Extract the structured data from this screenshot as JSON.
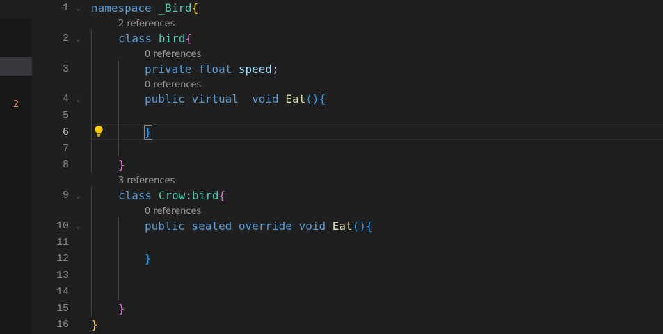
{
  "gutter": {
    "badge": "2"
  },
  "lines": [
    {
      "n": "1",
      "fold": "⌄",
      "tokens": [
        {
          "t": "namespace",
          "c": "kw"
        },
        {
          "t": " "
        },
        {
          "t": "_Bird",
          "c": "ty"
        },
        {
          "t": "{",
          "c": "br1"
        }
      ]
    },
    {
      "n": "2",
      "fold": "⌄",
      "lens": "2 references",
      "tokens": [
        {
          "t": "class",
          "c": "kw"
        },
        {
          "t": " "
        },
        {
          "t": "bird",
          "c": "ty"
        },
        {
          "t": "{",
          "c": "br2"
        }
      ]
    },
    {
      "n": "3",
      "lens": "0 references",
      "tokens": [
        {
          "t": "private",
          "c": "kw"
        },
        {
          "t": " "
        },
        {
          "t": "float",
          "c": "kw"
        },
        {
          "t": " "
        },
        {
          "t": "speed",
          "c": "var"
        },
        {
          "t": ";"
        }
      ]
    },
    {
      "n": "4",
      "fold": "⌄",
      "lens": "0 references",
      "tokens": [
        {
          "t": "public",
          "c": "kw"
        },
        {
          "t": " "
        },
        {
          "t": "virtual",
          "c": "kw"
        },
        {
          "t": "  "
        },
        {
          "t": "void",
          "c": "kw"
        },
        {
          "t": " "
        },
        {
          "t": "Eat",
          "c": "fn"
        },
        {
          "t": "(",
          "c": "br3"
        },
        {
          "t": ")",
          "c": "br3"
        },
        {
          "t": "{",
          "c": "br3 box"
        }
      ]
    },
    {
      "n": "5",
      "tokens": []
    },
    {
      "n": "6",
      "active": true,
      "tokens": [
        {
          "t": "}",
          "c": "br3 box"
        }
      ]
    },
    {
      "n": "7",
      "tokens": []
    },
    {
      "n": "8",
      "tokens": [
        {
          "t": "}",
          "c": "br2"
        }
      ]
    },
    {
      "n": "9",
      "fold": "⌄",
      "lens": "3 references",
      "tokens": [
        {
          "t": "class",
          "c": "kw"
        },
        {
          "t": " "
        },
        {
          "t": "Crow",
          "c": "ty"
        },
        {
          "t": ":"
        },
        {
          "t": "bird",
          "c": "ty"
        },
        {
          "t": "{",
          "c": "br2"
        }
      ]
    },
    {
      "n": "10",
      "fold": "⌄",
      "lens": "0 references",
      "tokens": [
        {
          "t": "public",
          "c": "kw"
        },
        {
          "t": " "
        },
        {
          "t": "sealed",
          "c": "kw"
        },
        {
          "t": " "
        },
        {
          "t": "override",
          "c": "kw"
        },
        {
          "t": " "
        },
        {
          "t": "void",
          "c": "kw"
        },
        {
          "t": " "
        },
        {
          "t": "Eat",
          "c": "fn"
        },
        {
          "t": "(",
          "c": "br3"
        },
        {
          "t": ")",
          "c": "br3"
        },
        {
          "t": "{",
          "c": "br3"
        }
      ]
    },
    {
      "n": "11",
      "tokens": []
    },
    {
      "n": "12",
      "tokens": [
        {
          "t": "}",
          "c": "br3"
        }
      ]
    },
    {
      "n": "13",
      "tokens": []
    },
    {
      "n": "14",
      "tokens": []
    },
    {
      "n": "15",
      "tokens": [
        {
          "t": "}",
          "c": "br2"
        }
      ]
    },
    {
      "n": "16",
      "tokens": [
        {
          "t": "}",
          "c": "br1"
        }
      ]
    }
  ]
}
